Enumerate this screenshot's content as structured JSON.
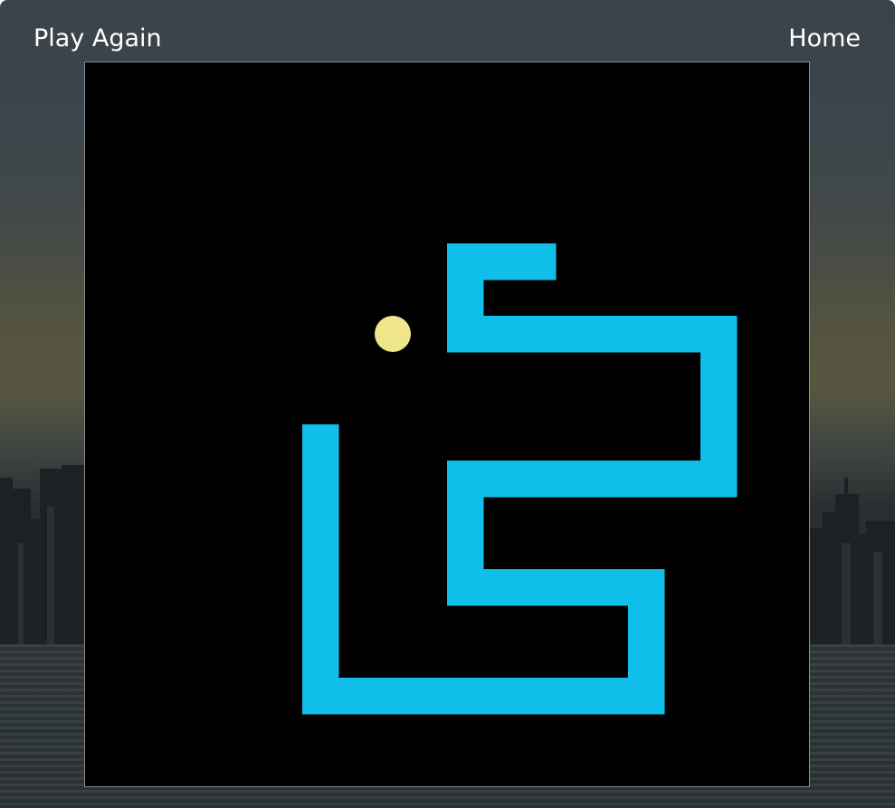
{
  "header": {
    "play_again_label": "Play Again",
    "home_label": "Home"
  },
  "game": {
    "grid": {
      "columns": 20,
      "rows": 20
    },
    "snake_color": "#10bfe9",
    "food_color": "#efe58b",
    "board_color": "#000000",
    "snake": [
      [
        6,
        10
      ],
      [
        6,
        11
      ],
      [
        6,
        12
      ],
      [
        6,
        13
      ],
      [
        6,
        14
      ],
      [
        6,
        15
      ],
      [
        6,
        16
      ],
      [
        6,
        17
      ],
      [
        7,
        17
      ],
      [
        8,
        17
      ],
      [
        9,
        17
      ],
      [
        10,
        17
      ],
      [
        11,
        17
      ],
      [
        12,
        17
      ],
      [
        13,
        17
      ],
      [
        14,
        17
      ],
      [
        15,
        17
      ],
      [
        15,
        16
      ],
      [
        15,
        15
      ],
      [
        15,
        14
      ],
      [
        14,
        14
      ],
      [
        13,
        14
      ],
      [
        12,
        14
      ],
      [
        11,
        14
      ],
      [
        10,
        14
      ],
      [
        10,
        13
      ],
      [
        10,
        12
      ],
      [
        10,
        11
      ],
      [
        11,
        11
      ],
      [
        12,
        11
      ],
      [
        13,
        11
      ],
      [
        14,
        11
      ],
      [
        15,
        11
      ],
      [
        16,
        11
      ],
      [
        17,
        11
      ],
      [
        17,
        10
      ],
      [
        17,
        9
      ],
      [
        17,
        8
      ],
      [
        17,
        7
      ],
      [
        16,
        7
      ],
      [
        15,
        7
      ],
      [
        14,
        7
      ],
      [
        13,
        7
      ],
      [
        12,
        7
      ],
      [
        11,
        7
      ],
      [
        10,
        7
      ],
      [
        10,
        6
      ],
      [
        10,
        5
      ],
      [
        11,
        5
      ],
      [
        12,
        5
      ]
    ],
    "food": [
      8,
      7
    ]
  }
}
